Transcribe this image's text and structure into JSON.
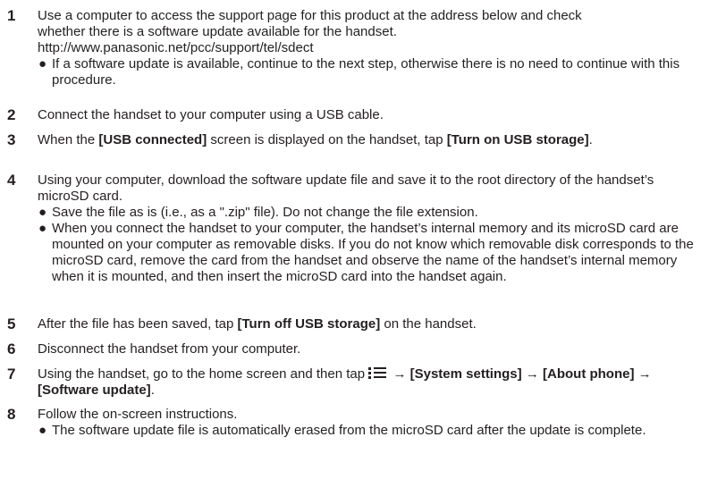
{
  "steps": [
    {
      "num": "1",
      "lines": [
        "Use a computer to access the support page for this product at the address below and check",
        "whether there is a software update available for the handset.",
        "http://www.panasonic.net/pcc/support/tel/sdect"
      ],
      "bullets": [
        "If a software update is available, continue to the next step, otherwise there is no need to continue with this procedure."
      ]
    },
    {
      "num": "2",
      "text": "Connect the handset to your computer using a USB cable."
    },
    {
      "num": "3",
      "pre": "When the ",
      "b1": "[USB connected]",
      "mid": " screen is displayed on the handset, tap ",
      "b2": "[Turn on USB storage]",
      "post": "."
    },
    {
      "num": "4",
      "text": "Using your computer, download the software update file and save it to the root directory of the handset’s microSD card.",
      "bullets": [
        "Save the file as is (i.e., as a \".zip\" file). Do not change the file extension.",
        "When you connect the handset to your computer, the handset’s internal memory and its microSD card are mounted on your computer as removable disks. If you do not know which removable disk corresponds to the microSD card, remove the card from the handset and observe the name of the handset’s internal memory when it is mounted, and then insert the microSD card into the handset again."
      ]
    },
    {
      "num": "5",
      "pre": "After the file has been saved, tap ",
      "b1": "[Turn off USB storage]",
      "post": " on the handset."
    },
    {
      "num": "6",
      "text": "Disconnect the handset from your computer."
    },
    {
      "num": "7",
      "pre": "Using the handset, go to the home screen and then tap ",
      "icon": "menu-list-icon",
      "arrow": "→",
      "b1": "[System settings]",
      "b2": "[About phone]",
      "b3": "[Software update]",
      "post": "."
    },
    {
      "num": "8",
      "text": "Follow the on-screen instructions.",
      "bullets": [
        "The software update file is automatically erased from the microSD card after the update is complete."
      ]
    }
  ],
  "bullet_glyph": "●"
}
